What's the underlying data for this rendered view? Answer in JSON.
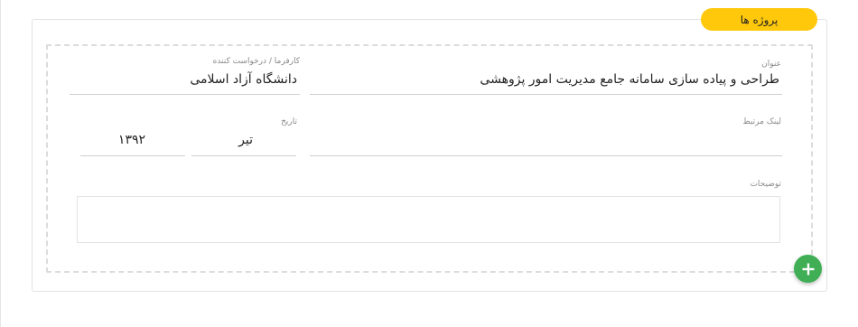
{
  "section": {
    "badge_label": "پروژه ها"
  },
  "project": {
    "title_label": "عنوان",
    "title_value": "طراحی و پیاده سازی سامانه جامع مدیریت امور پژوهشی",
    "client_label": "کارفرما / درخواست کننده",
    "client_value": "دانشگاه آزاد اسلامی",
    "link_label": "لینک مرتبط",
    "link_value": "",
    "date_label": "تاریخ",
    "date_month": "تیر",
    "date_year": "۱۳۹۲",
    "description_label": "توضیحات",
    "description_value": ""
  },
  "actions": {
    "add_icon": "plus-icon",
    "add_color": "#3fae54"
  },
  "colors": {
    "badge": "#ffc80a"
  }
}
